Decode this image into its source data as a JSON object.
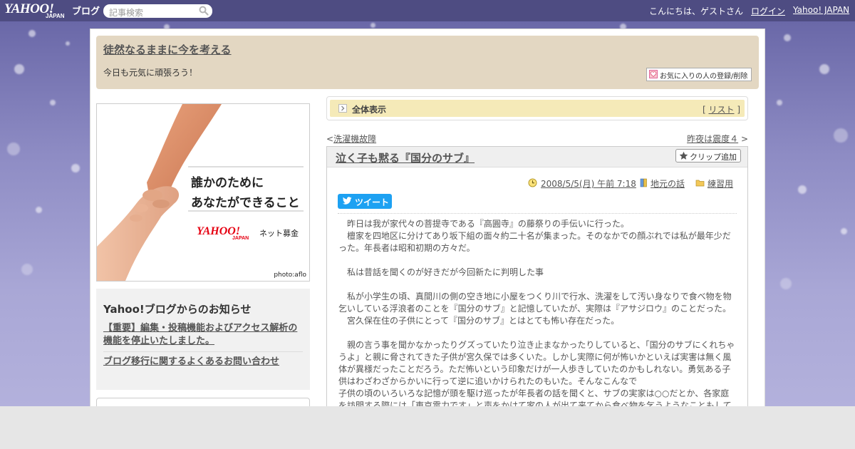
{
  "topbar": {
    "logo_main": "YAHOO!",
    "logo_sub": "JAPAN",
    "logo_blog": "ブログ",
    "search_placeholder": "記事検索",
    "greeting": "こんにちは、ゲストさん",
    "login": "ログイン",
    "yahoo_japan": "Yahoo! JAPAN"
  },
  "header": {
    "blog_title": "徒然なるままに今を考える",
    "description": "今日も元気に頑張ろう！",
    "fav_button": "お気に入りの人の登録/削除"
  },
  "banner": {
    "line1": "誰かのために",
    "line2": "あなたができること",
    "logo": "YAHOO!",
    "logo_sub": "JAPAN",
    "service": "ネット募金",
    "credit": "photo:aflo"
  },
  "notice": {
    "title": "Yahoo!ブログからのお知らせ",
    "items": [
      "【重要】編集・投稿機能およびアクセス解析の機能を停止いたしました。",
      "ブログ移行に関するよくあるお問い合わせ"
    ]
  },
  "category_bar": {
    "label": "全体表示",
    "list_link": "リスト"
  },
  "nav": {
    "prev": "洗濯機故障",
    "next": "昨夜は震度４"
  },
  "article": {
    "title": "泣く子も黙る『国分のサブ』",
    "clip_button": "クリップ追加",
    "date": "2008/5/5(月) 午前 7:18",
    "category": "地元の話",
    "folder": "練習用",
    "tweet": "ツイート",
    "paragraphs": [
      "　昨日は我が家代々の菩提寺である『高圓寺』の藤祭りの手伝いに行った。",
      "　檀家を四地区に分けてあり坂下組の面々約二十名が集まった。そのなかでの顔ぶれでは私が最年少だった。年長者は昭和初期の方々だ。",
      " ",
      "　私は昔話を聞くのが好きだが今回新たに判明した事",
      " ",
      "　私が小学生の頃、真間川の側の空き地に小屋をつくり川で行水、洗濯をして汚い身なりで食べ物を物乞いしている浮浪者のことを『国分のサブ』と記憶していたが、実際は『アサジロウ』のことだった。",
      "　宮久保在住の子供にとって『国分のサブ』とはとても怖い存在だった。",
      " ",
      "　親の言う事を聞かなかったりグズっていたり泣き止まなかったりしていると、「国分のサブにくれちゃうよ」と親に脅されてきた子供が宮久保では多くいた。しかし実際に何が怖いかといえば実害は無く風体が異様だったことだろう。ただ怖いという印象だけが一人歩きしていたのかもしれない。勇気ある子供はわざわざからかいに行って逆に追いかけられたのもいた。そんなこんなで",
      "子供の頃のいろいろな記憶が頭を駆け巡ったが年長者の話を聞くと、サブの実家は○○だとか、各家庭を訪問する際には「東京電力です」と声をかけて家の人が出て来てから食べ物を乞うようなこともしていた"
    ]
  },
  "colors": {
    "topbar": "#4e4c82",
    "header_bg": "#e3d7c2",
    "category_bg": "#f5eab8",
    "tweet_blue": "#1da1f2"
  }
}
